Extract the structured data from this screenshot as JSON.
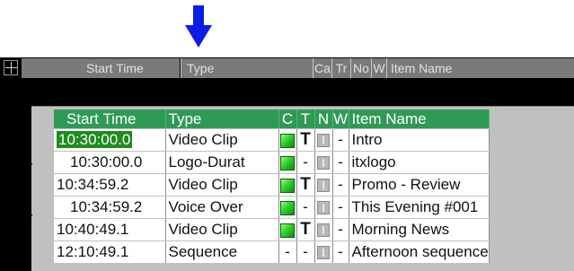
{
  "annotation": {
    "arrow_color": "#0b1de6",
    "arrow_icon": "down-arrow-icon"
  },
  "top_header": {
    "expand_icon": "plus-box-icon",
    "columns": [
      "Start Time",
      "Type",
      "Ca",
      "Tr",
      "No",
      "W",
      "Item Name"
    ]
  },
  "grid": {
    "columns": [
      "Start Time",
      "Type",
      "C",
      "T",
      "N",
      "W",
      "Item Name"
    ],
    "rows": [
      {
        "start_time": "10:30:00.0",
        "type": "Video Clip",
        "c": "flag",
        "t": "T",
        "n": "info",
        "w": "-",
        "item_name": "Intro",
        "highlight": true
      },
      {
        "start_time": "10:30:00.0",
        "type": "Logo-Durat",
        "c": "flag",
        "t": "-",
        "n": "info",
        "w": "-",
        "item_name": "itxlogo"
      },
      {
        "start_time": "10:34:59.2",
        "type": "Video Clip",
        "c": "flag",
        "t": "T",
        "n": "info",
        "w": "-",
        "item_name": "Promo - Review"
      },
      {
        "start_time": "10:34:59.2",
        "type": "Voice Over",
        "c": "flag",
        "t": "-",
        "n": "info",
        "w": "-",
        "item_name": "This Evening #001"
      },
      {
        "start_time": "10:40:49.1",
        "type": "Video Clip",
        "c": "flag",
        "t": "T",
        "n": "info",
        "w": "-",
        "item_name": "Morning News"
      },
      {
        "start_time": "12:10:49.1",
        "type": "Sequence",
        "c": "-",
        "t": "-",
        "n": "info",
        "w": "-",
        "item_name": "Afternoon sequence"
      }
    ]
  },
  "colors": {
    "header_green": "#2f9a55",
    "highlight_green": "#1e8c1e",
    "strip_gray": "#7a7a7a"
  }
}
